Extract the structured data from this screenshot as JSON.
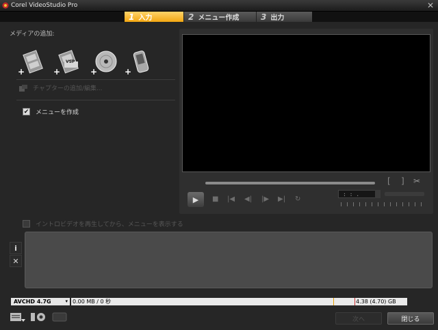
{
  "window": {
    "title": "Corel VideoStudio Pro",
    "close_glyph": "✕"
  },
  "steps": [
    {
      "num": "1",
      "label": "入力"
    },
    {
      "num": "2",
      "label": "メニュー作成"
    },
    {
      "num": "3",
      "label": "出力"
    }
  ],
  "media": {
    "heading": "メディアの追加:",
    "items": [
      {
        "icon": "add-video-icon"
      },
      {
        "icon": "add-vsp-project-icon",
        "badge": "VSP"
      },
      {
        "icon": "add-disc-icon"
      },
      {
        "icon": "add-mobile-device-icon"
      }
    ],
    "plus": "+"
  },
  "chapter": {
    "label": "チャプターの追加/編集..."
  },
  "menu_option": {
    "label": "メニューを作成",
    "checked": true,
    "check_glyph": "✔"
  },
  "intro_option": {
    "label": "イントロビデオを再生してから、メニューを表示する",
    "checked": false
  },
  "preview": {
    "mark_in": "[",
    "mark_out": "]",
    "cut_glyph": "✂",
    "play_glyph": "▶",
    "controls": [
      "■",
      "|◀",
      "◀|",
      "|▶",
      "▶|",
      "↻"
    ],
    "timecode": ": : ."
  },
  "side_buttons": {
    "info": "i",
    "remove": "✕"
  },
  "footer": {
    "disc_type": "AVCHD 4.7G",
    "disc_arrow": "▾",
    "used": "0.00 MB / 0 秒",
    "total": "4.38 (4.70) GB",
    "next_label": "次へ",
    "close_label": "閉じる"
  },
  "colors": {
    "accent": "#f3a712",
    "background": "#262626",
    "preview_bg": "#000000"
  }
}
